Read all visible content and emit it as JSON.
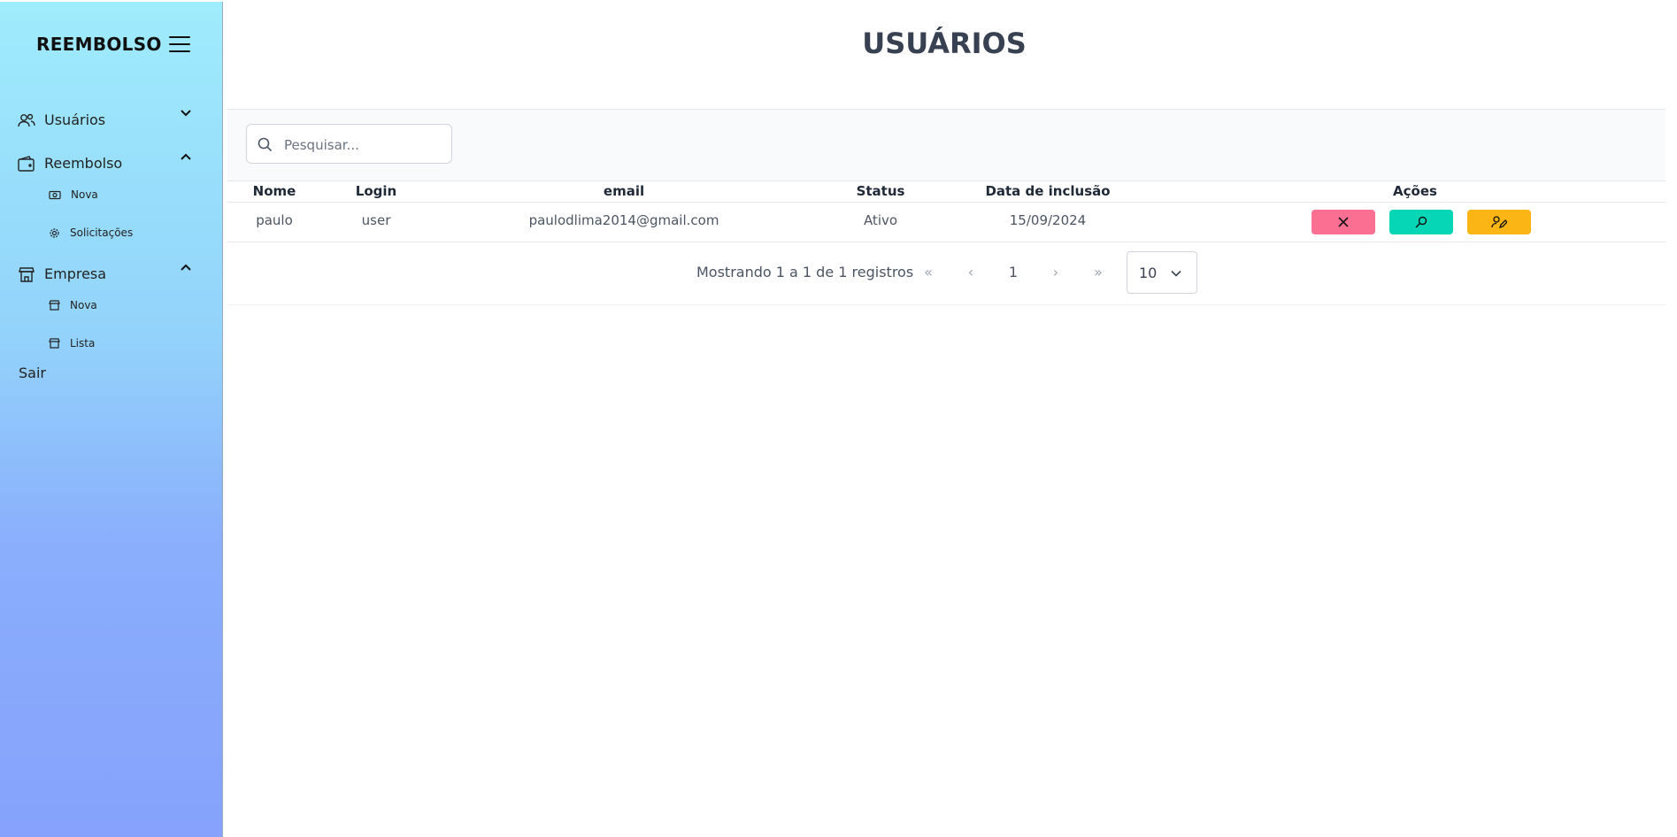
{
  "sidebar": {
    "brand": "REEMBOLSO",
    "menu_icon": "hamburger-menu-icon",
    "groups": [
      {
        "label": "Usuários",
        "icon": "users-icon",
        "chevron": "chevron-down-icon",
        "items": []
      },
      {
        "label": "Reembolso",
        "icon": "wallet-icon",
        "chevron": "chevron-up-icon",
        "items": [
          {
            "label": "Nova",
            "icon": "money-icon"
          },
          {
            "label": "Solicitações",
            "icon": "gear-icon"
          }
        ]
      },
      {
        "label": "Empresa",
        "icon": "building-icon",
        "chevron": "chevron-up-icon",
        "items": [
          {
            "label": "Nova",
            "icon": "building-icon"
          },
          {
            "label": "Lista",
            "icon": "building-icon"
          }
        ]
      }
    ],
    "logout": "Sair"
  },
  "page": {
    "title": "USUÁRIOS"
  },
  "search": {
    "placeholder": "Pesquisar...",
    "value": ""
  },
  "table": {
    "columns": [
      "Nome",
      "Login",
      "email",
      "Status",
      "Data de inclusão",
      "Ações"
    ],
    "rows": [
      {
        "nome": "paulo",
        "login": "user",
        "email": "paulodlima2014@gmail.com",
        "status": "Ativo",
        "data": "15/09/2024"
      }
    ],
    "actions": [
      {
        "name": "delete",
        "icon": "close-icon",
        "color": "#fb6f92"
      },
      {
        "name": "view",
        "icon": "search-icon",
        "color": "#06d6b5"
      },
      {
        "name": "edit",
        "icon": "user-edit-icon",
        "color": "#fbb616"
      }
    ]
  },
  "pagination": {
    "summary": "Mostrando 1 a 1 de 1 registros",
    "first": "«",
    "prev": "‹",
    "current_page": "1",
    "next": "›",
    "last": "»",
    "rows_per_page": "10"
  }
}
